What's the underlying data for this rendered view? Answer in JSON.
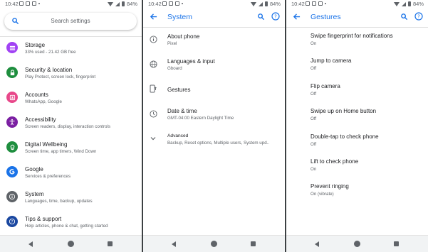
{
  "status_bar": {
    "time": "10:42",
    "battery": "84%"
  },
  "colors": {
    "accent": "#1a73e8",
    "text_primary": "#202124",
    "text_secondary": "#5f6368",
    "nav_bg": "#f1f3f4"
  },
  "settings": {
    "search_placeholder": "Search settings",
    "items": [
      {
        "title": "Storage",
        "subtitle": "33% used - 21.42 GB free",
        "icon": "storage-icon",
        "color": "#a142f4"
      },
      {
        "title": "Security & location",
        "subtitle": "Play Protect, screen lock, fingerprint",
        "icon": "lock-icon",
        "color": "#1e8e3e"
      },
      {
        "title": "Accounts",
        "subtitle": "WhatsApp, Google",
        "icon": "account-icon",
        "color": "#e8488a"
      },
      {
        "title": "Accessibility",
        "subtitle": "Screen readers, display, interaction controls",
        "icon": "accessibility-icon",
        "color": "#7b1fa2"
      },
      {
        "title": "Digital Wellbeing",
        "subtitle": "Screen time, app timers, Wind Down",
        "icon": "wellbeing-icon",
        "color": "#1e8e3e"
      },
      {
        "title": "Google",
        "subtitle": "Services & preferences",
        "icon": "google-icon",
        "color": "#1a73e8"
      },
      {
        "title": "System",
        "subtitle": "Languages, time, backup, updates",
        "icon": "info-icon",
        "color": "#5f6368"
      },
      {
        "title": "Tips & support",
        "subtitle": "Help articles, phone & chat, getting started",
        "icon": "help-icon",
        "color": "#1a47a0"
      }
    ]
  },
  "system": {
    "title": "System",
    "items": [
      {
        "title": "About phone",
        "subtitle": "Pixel",
        "icon": "info-icon"
      },
      {
        "title": "Languages & input",
        "subtitle": "Gboard",
        "icon": "globe-icon"
      },
      {
        "title": "Gestures",
        "subtitle": "",
        "icon": "gesture-phone-icon"
      },
      {
        "title": "Date & time",
        "subtitle": "GMT-04:00 Eastern Daylight Time",
        "icon": "clock-icon"
      },
      {
        "title": "Advanced",
        "subtitle": "Backup, Reset options, Multiple users, System upd..",
        "icon": "chevron-down-icon"
      }
    ]
  },
  "gestures": {
    "title": "Gestures",
    "items": [
      {
        "title": "Swipe fingerprint for notifications",
        "subtitle": "On"
      },
      {
        "title": "Jump to camera",
        "subtitle": "Off"
      },
      {
        "title": "Flip camera",
        "subtitle": "Off"
      },
      {
        "title": "Swipe up on Home button",
        "subtitle": "Off"
      },
      {
        "title": "Double-tap to check phone",
        "subtitle": "Off"
      },
      {
        "title": "Lift to check phone",
        "subtitle": "On"
      },
      {
        "title": "Prevent ringing",
        "subtitle": "On (vibrate)"
      }
    ]
  }
}
